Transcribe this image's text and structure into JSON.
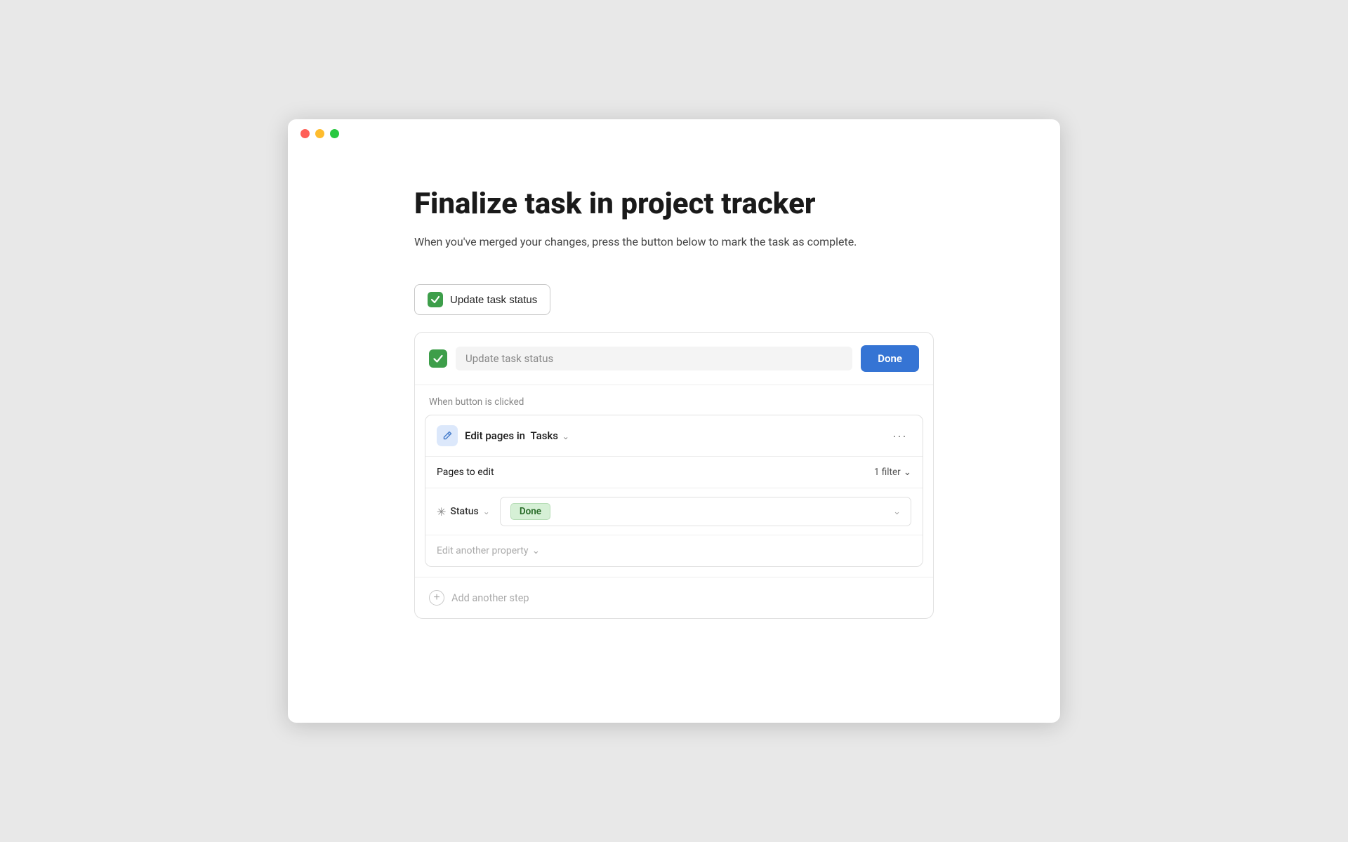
{
  "window": {
    "traffic_close": "close",
    "traffic_min": "minimize",
    "traffic_max": "maximize"
  },
  "page": {
    "title": "Finalize task in project tracker",
    "subtitle": "When you've merged your changes, press the button below to mark the task as complete.",
    "update_btn_label": "Update task status"
  },
  "card": {
    "input_value": "Update task status",
    "done_btn_label": "Done",
    "when_label": "When button is clicked",
    "action": {
      "title_prefix": "Edit pages in",
      "db_name": "Tasks",
      "pages_label": "Pages to edit",
      "filter_label": "1 filter",
      "status_label": "Status",
      "status_value": "Done",
      "edit_another_label": "Edit another property"
    },
    "add_step_label": "Add another step"
  }
}
